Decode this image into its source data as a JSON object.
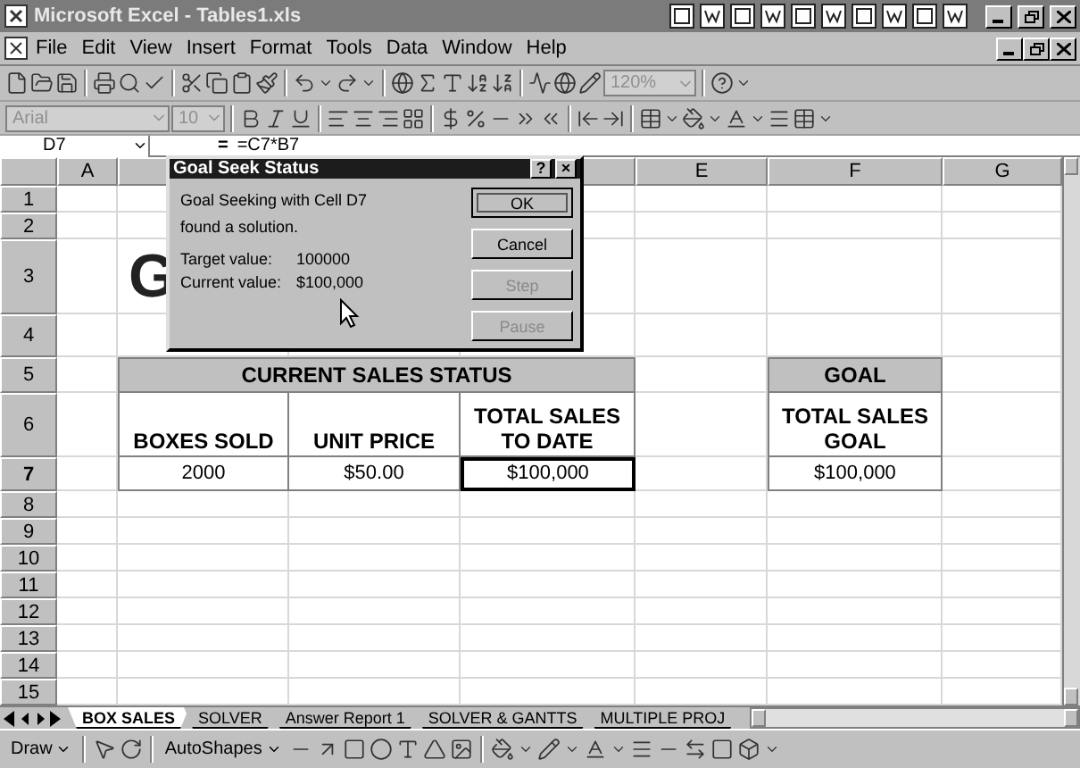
{
  "window": {
    "title": "Microsoft Excel - Tables1.xls"
  },
  "menu": [
    {
      "label": "File"
    },
    {
      "label": "Edit"
    },
    {
      "label": "View"
    },
    {
      "label": "Insert"
    },
    {
      "label": "Format"
    },
    {
      "label": "Tools"
    },
    {
      "label": "Data"
    },
    {
      "label": "Window"
    },
    {
      "label": "Help"
    }
  ],
  "standard_toolbar": {
    "zoom": "120%"
  },
  "formatting_toolbar": {
    "font": "Arial",
    "size": "10"
  },
  "formula_bar": {
    "name_box": "D7",
    "equals": "=",
    "formula": "=C7*B7"
  },
  "sheet": {
    "columns": [
      {
        "label": "A"
      },
      {
        "label": "E"
      },
      {
        "label": "F"
      },
      {
        "label": "G"
      }
    ],
    "rows": [
      {
        "label": "1",
        "selected": false
      },
      {
        "label": "2",
        "selected": false
      },
      {
        "label": "3",
        "selected": false
      },
      {
        "label": "4",
        "selected": false
      },
      {
        "label": "5",
        "selected": false
      },
      {
        "label": "6",
        "selected": false
      },
      {
        "label": "7",
        "selected": true
      },
      {
        "label": "8",
        "selected": false
      },
      {
        "label": "9",
        "selected": false
      },
      {
        "label": "10",
        "selected": false
      },
      {
        "label": "11",
        "selected": false
      },
      {
        "label": "12",
        "selected": false
      },
      {
        "label": "13",
        "selected": false
      },
      {
        "label": "14",
        "selected": false
      },
      {
        "label": "15",
        "selected": false
      }
    ],
    "title_cell": "G",
    "sales_table": {
      "title": "CURRENT SALES STATUS",
      "headers": [
        "BOXES SOLD",
        "UNIT PRICE",
        "TOTAL SALES\nTO DATE"
      ],
      "values": [
        {
          "text": "2000",
          "selected": false
        },
        {
          "text": "$50.00",
          "selected": false
        },
        {
          "text": "$100,000",
          "selected": true
        }
      ]
    },
    "goal_table": {
      "title": "GOAL",
      "header": "TOTAL SALES\nGOAL",
      "value": "$100,000"
    }
  },
  "sheet_tabs": [
    {
      "label": "BOX SALES",
      "selected": true
    },
    {
      "label": "SOLVER",
      "selected": false
    },
    {
      "label": "Answer Report 1",
      "selected": false
    },
    {
      "label": "SOLVER & GANTTS",
      "selected": false
    },
    {
      "label": "MULTIPLE PROJ",
      "selected": false
    }
  ],
  "drawing_toolbar": {
    "draw": "Draw",
    "autoshapes": "AutoShapes"
  },
  "dialog": {
    "title": "Goal Seek Status",
    "help": "?",
    "close": "×",
    "message": "Goal Seeking with Cell D7\nfound a solution.",
    "fields": [
      {
        "label": "Target value:",
        "value": "100000"
      },
      {
        "label": "Current value:",
        "value": "$100,000"
      }
    ],
    "buttons": [
      {
        "label": "OK",
        "default": true,
        "disabled": false
      },
      {
        "label": "Cancel",
        "default": false,
        "disabled": false
      },
      {
        "label": "Step",
        "default": false,
        "disabled": true
      },
      {
        "label": "Pause",
        "default": false,
        "disabled": true
      }
    ]
  }
}
